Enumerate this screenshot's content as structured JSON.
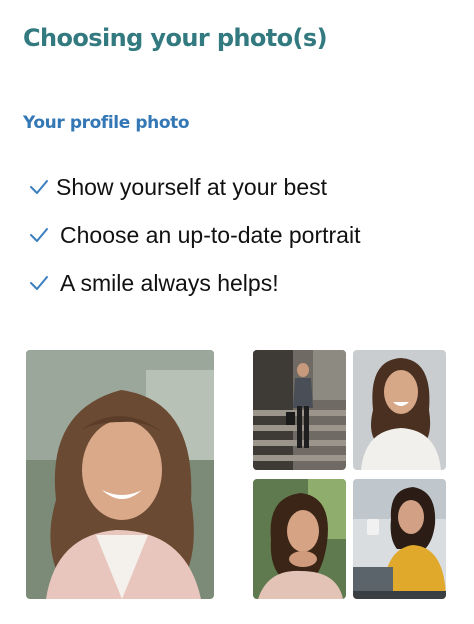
{
  "header": {
    "title": "Choosing your photo(s)"
  },
  "section": {
    "title": "Your profile photo"
  },
  "tips": [
    {
      "icon": "check-icon",
      "label": "Show yourself at your best"
    },
    {
      "icon": "check-icon",
      "label": "Choose an up-to-date portrait"
    },
    {
      "icon": "check-icon",
      "label": "A smile always helps!"
    }
  ],
  "colors": {
    "title": "#327a80",
    "section_title": "#3377b5",
    "check": "#3a7ec0",
    "text": "#111111"
  }
}
